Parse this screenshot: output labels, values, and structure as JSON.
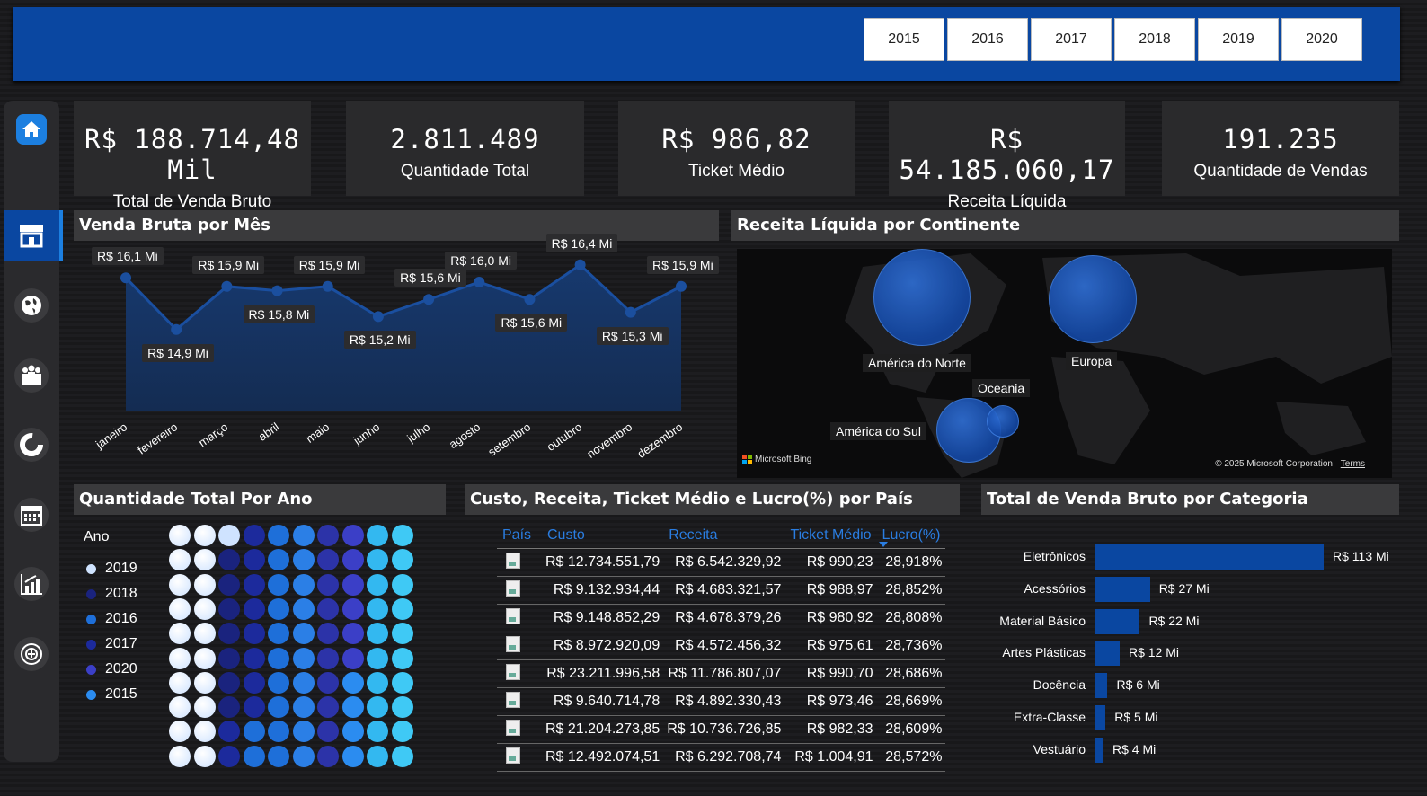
{
  "years": [
    "2015",
    "2016",
    "2017",
    "2018",
    "2019",
    "2020"
  ],
  "kpis": [
    {
      "value": "R$ 188.714,48 Mil",
      "label": "Total de Venda Bruto"
    },
    {
      "value": "2.811.489",
      "label": "Quantidade Total"
    },
    {
      "value": "R$ 986,82",
      "label": "Ticket Médio"
    },
    {
      "value": "R$ 54.185.060,17",
      "label": "Receita Líquida"
    },
    {
      "value": "191.235",
      "label": "Quantidade de Vendas"
    }
  ],
  "nav": [
    "home-icon",
    "store-icon",
    "globe-icon",
    "people-icon",
    "donut-chart-icon",
    "calendar-icon",
    "bar-chart-icon",
    "target-icon"
  ],
  "line_panel": {
    "title": "Venda Bruta por Mês"
  },
  "map_panel": {
    "title": "Receita Líquida por Continente",
    "regions": [
      "América do Norte",
      "Europa",
      "Oceania",
      "América do Sul"
    ],
    "bing": "Microsoft Bing",
    "copyright": "© 2025 Microsoft Corporation",
    "terms": "Terms"
  },
  "dots_panel": {
    "title": "Quantidade Total Por Ano",
    "legend_title": "Ano",
    "legend": [
      {
        "label": "2019",
        "color": "#cfe3ff"
      },
      {
        "label": "2018",
        "color": "#1a237e"
      },
      {
        "label": "2016",
        "color": "#1e6fd9"
      },
      {
        "label": "2017",
        "color": "#1c2a9c"
      },
      {
        "label": "2020",
        "color": "#3b3fc7"
      },
      {
        "label": "2015",
        "color": "#2b8cf0"
      }
    ]
  },
  "table_panel": {
    "title": "Custo, Receita, Ticket Médio e Lucro(%) por País",
    "headers": [
      "País",
      "Custo",
      "Receita",
      "Ticket Médio",
      "Lucro(%)"
    ],
    "rows": [
      [
        "R$ 12.734.551,79",
        "R$ 6.542.329,92",
        "R$ 990,23",
        "28,918%"
      ],
      [
        "R$ 9.132.934,44",
        "R$ 4.683.321,57",
        "R$ 988,97",
        "28,852%"
      ],
      [
        "R$ 9.148.852,29",
        "R$ 4.678.379,26",
        "R$ 980,92",
        "28,808%"
      ],
      [
        "R$ 8.972.920,09",
        "R$ 4.572.456,32",
        "R$ 975,61",
        "28,736%"
      ],
      [
        "R$ 23.211.996,58",
        "R$ 11.786.807,07",
        "R$ 990,70",
        "28,686%"
      ],
      [
        "R$ 9.640.714,78",
        "R$ 4.892.330,43",
        "R$ 973,46",
        "28,669%"
      ],
      [
        "R$ 21.204.273,85",
        "R$ 10.736.726,85",
        "R$ 982,33",
        "28,609%"
      ],
      [
        "R$ 12.492.074,51",
        "R$ 6.292.708,74",
        "R$ 1.004,91",
        "28,572%"
      ]
    ]
  },
  "bar_panel": {
    "title": "Total de Venda Bruto por Categoria"
  },
  "chart_data": [
    {
      "type": "area",
      "title": "Venda Bruta por Mês",
      "categories": [
        "janeiro",
        "fevereiro",
        "março",
        "abril",
        "maio",
        "junho",
        "julho",
        "agosto",
        "setembro",
        "outubro",
        "novembro",
        "dezembro"
      ],
      "values": [
        16.1,
        14.9,
        15.9,
        15.8,
        15.9,
        15.2,
        15.6,
        16.0,
        15.6,
        16.4,
        15.3,
        15.9
      ],
      "labels": [
        "R$ 16,1 Mi",
        "R$ 14,9 Mi",
        "R$ 15,9 Mi",
        "R$ 15,8 Mi",
        "R$ 15,9 Mi",
        "R$ 15,2 Mi",
        "R$ 15,6 Mi",
        "R$ 16,0 Mi",
        "R$ 15,6 Mi",
        "R$ 16,4 Mi",
        "R$ 15,3 Mi",
        "R$ 15,9 Mi"
      ],
      "ylim": [
        13.0,
        16.5
      ],
      "color": "#1a4fa0"
    },
    {
      "type": "bar",
      "title": "Total de Venda Bruto por Categoria",
      "orientation": "horizontal",
      "categories": [
        "Eletrônicos",
        "Acessórios",
        "Material Básico",
        "Artes Plásticas",
        "Docência",
        "Extra-Classe",
        "Vestuário"
      ],
      "values": [
        113,
        27,
        22,
        12,
        6,
        5,
        4
      ],
      "labels": [
        "R$ 113 Mi",
        "R$ 27 Mi",
        "R$ 22 Mi",
        "R$ 12 Mi",
        "R$ 6 Mi",
        "R$ 5 Mi",
        "R$ 4 Mi"
      ],
      "color": "#0a47a1"
    }
  ]
}
